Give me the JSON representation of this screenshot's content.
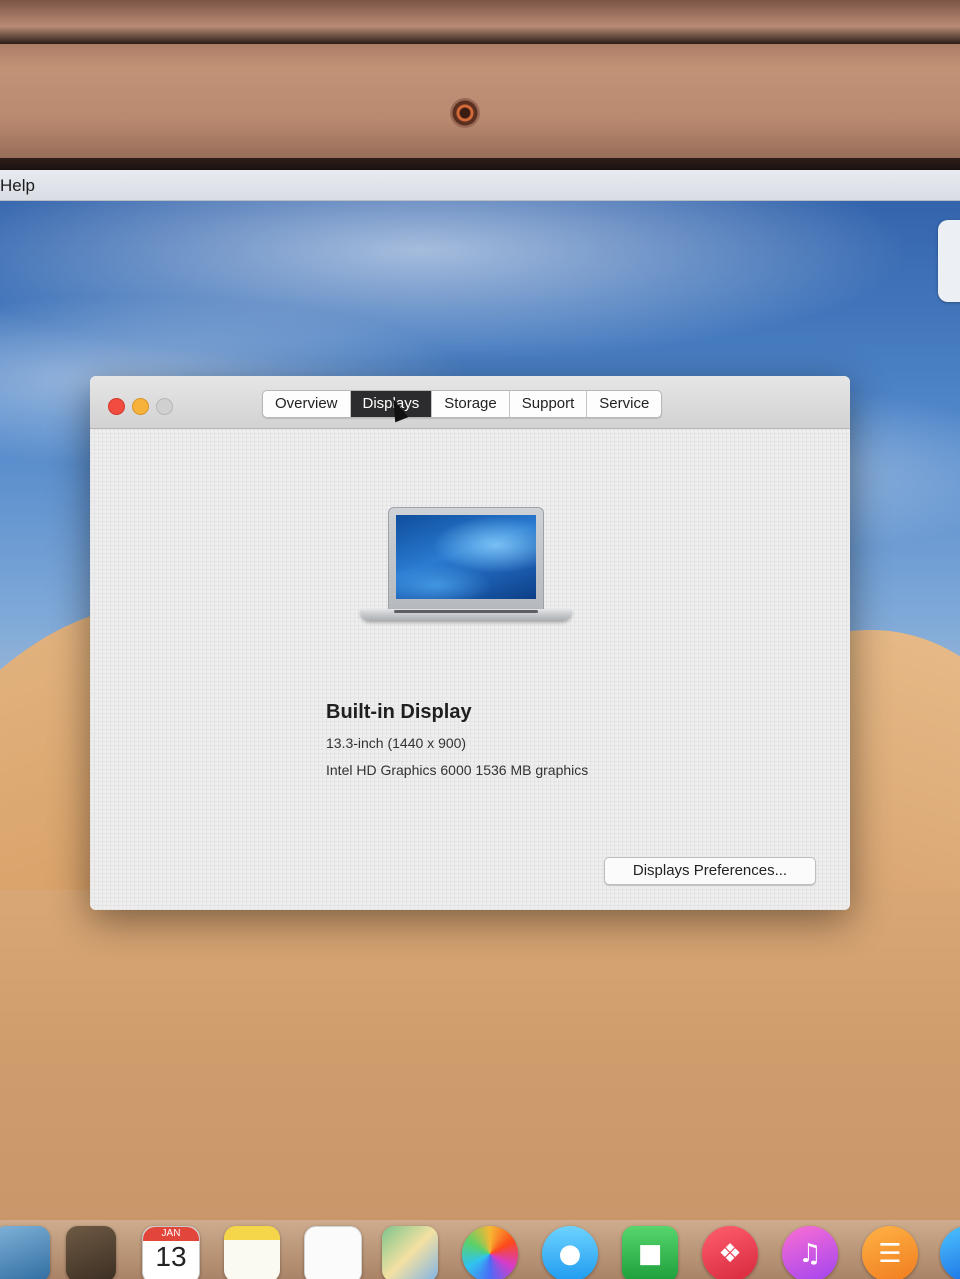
{
  "menubar": {
    "visible_item": "Help"
  },
  "window": {
    "tabs": [
      {
        "label": "Overview",
        "active": false
      },
      {
        "label": "Displays",
        "active": true
      },
      {
        "label": "Storage",
        "active": false
      },
      {
        "label": "Support",
        "active": false
      },
      {
        "label": "Service",
        "active": false
      }
    ],
    "display": {
      "title": "Built-in Display",
      "size_resolution": "13.3-inch (1440 x 900)",
      "graphics": "Intel HD Graphics 6000 1536 MB graphics"
    },
    "preferences_button_label": "Displays Preferences..."
  },
  "dock": {
    "calendar": {
      "month": "JAN",
      "day": "13"
    },
    "icons": [
      "preview-icon",
      "notes-icon",
      "calendar-icon",
      "stickies-icon",
      "reminders-icon",
      "maps-icon",
      "photos-icon",
      "messages-icon",
      "facetime-icon",
      "news-icon",
      "itunes-icon",
      "books-icon",
      "app-store-icon"
    ]
  },
  "colors": {
    "close": "#f24b3f",
    "minimize": "#f6b23a",
    "zoom_disabled": "#d0d0d0",
    "active_tab": "#2c2c2e"
  }
}
